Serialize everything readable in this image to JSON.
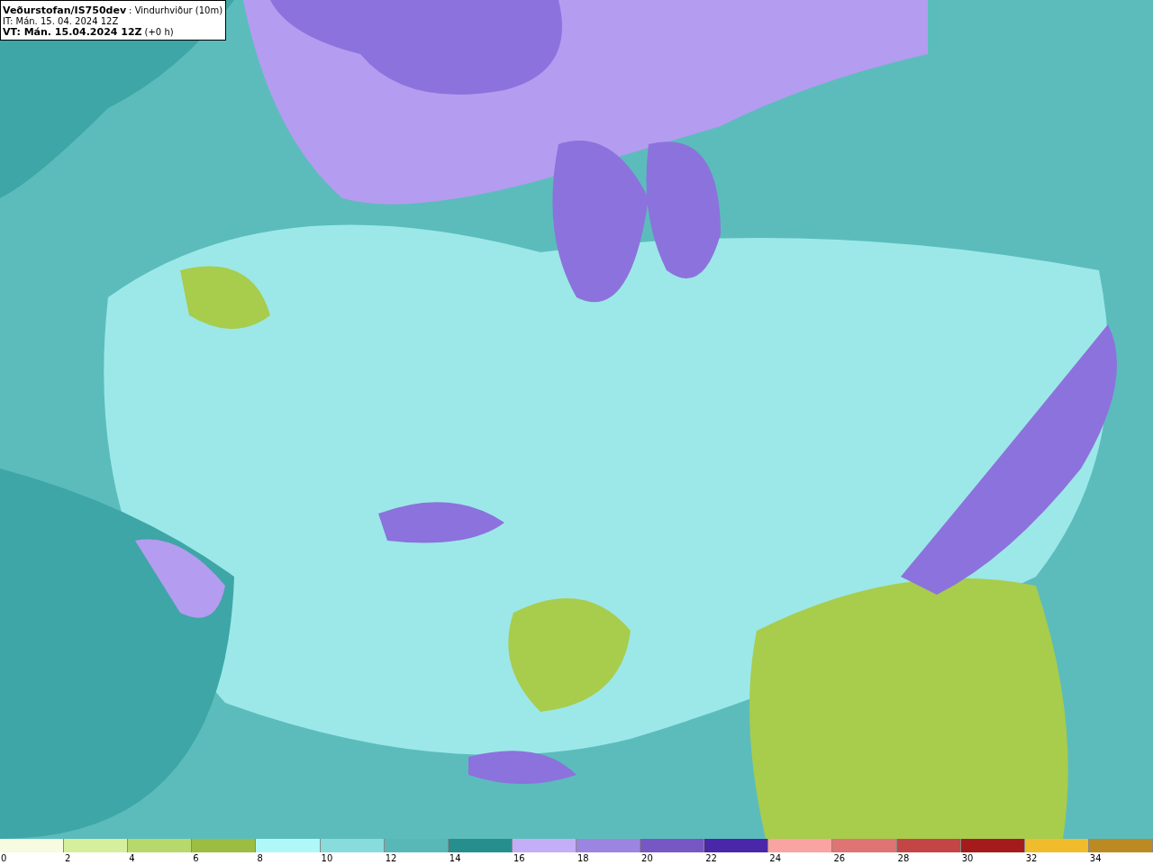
{
  "title": {
    "model": "Veðurstofan/IS750dev",
    "field": ": Vindurhviður (10m)",
    "it": "IT: Mán. 15. 04. 2024 12Z",
    "vt": "VT: Mán. 15.04.2024 12Z",
    "lead": "(+0 h)"
  },
  "legend": [
    {
      "color": "#f7fbdf",
      "label": "0"
    },
    {
      "color": "#d6ef9c",
      "label": "2"
    },
    {
      "color": "#b7d96c",
      "label": "4"
    },
    {
      "color": "#9bbd42",
      "label": "6"
    },
    {
      "color": "#b0f8f8",
      "label": "8"
    },
    {
      "color": "#88dcdc",
      "label": "10"
    },
    {
      "color": "#58b8b8",
      "label": "12"
    },
    {
      "color": "#278e8e",
      "label": "14"
    },
    {
      "color": "#c4aef8",
      "label": "16"
    },
    {
      "color": "#9c85e0",
      "label": "18"
    },
    {
      "color": "#7657c4",
      "label": "20"
    },
    {
      "color": "#4a26a8",
      "label": "22"
    },
    {
      "color": "#f9a3a3",
      "label": "24"
    },
    {
      "color": "#e07474",
      "label": "26"
    },
    {
      "color": "#c44545",
      "label": "28"
    },
    {
      "color": "#a51a1a",
      "label": "30"
    },
    {
      "color": "#f0bc2c",
      "label": "32"
    },
    {
      "color": "#bb8a22",
      "label": "34"
    }
  ]
}
